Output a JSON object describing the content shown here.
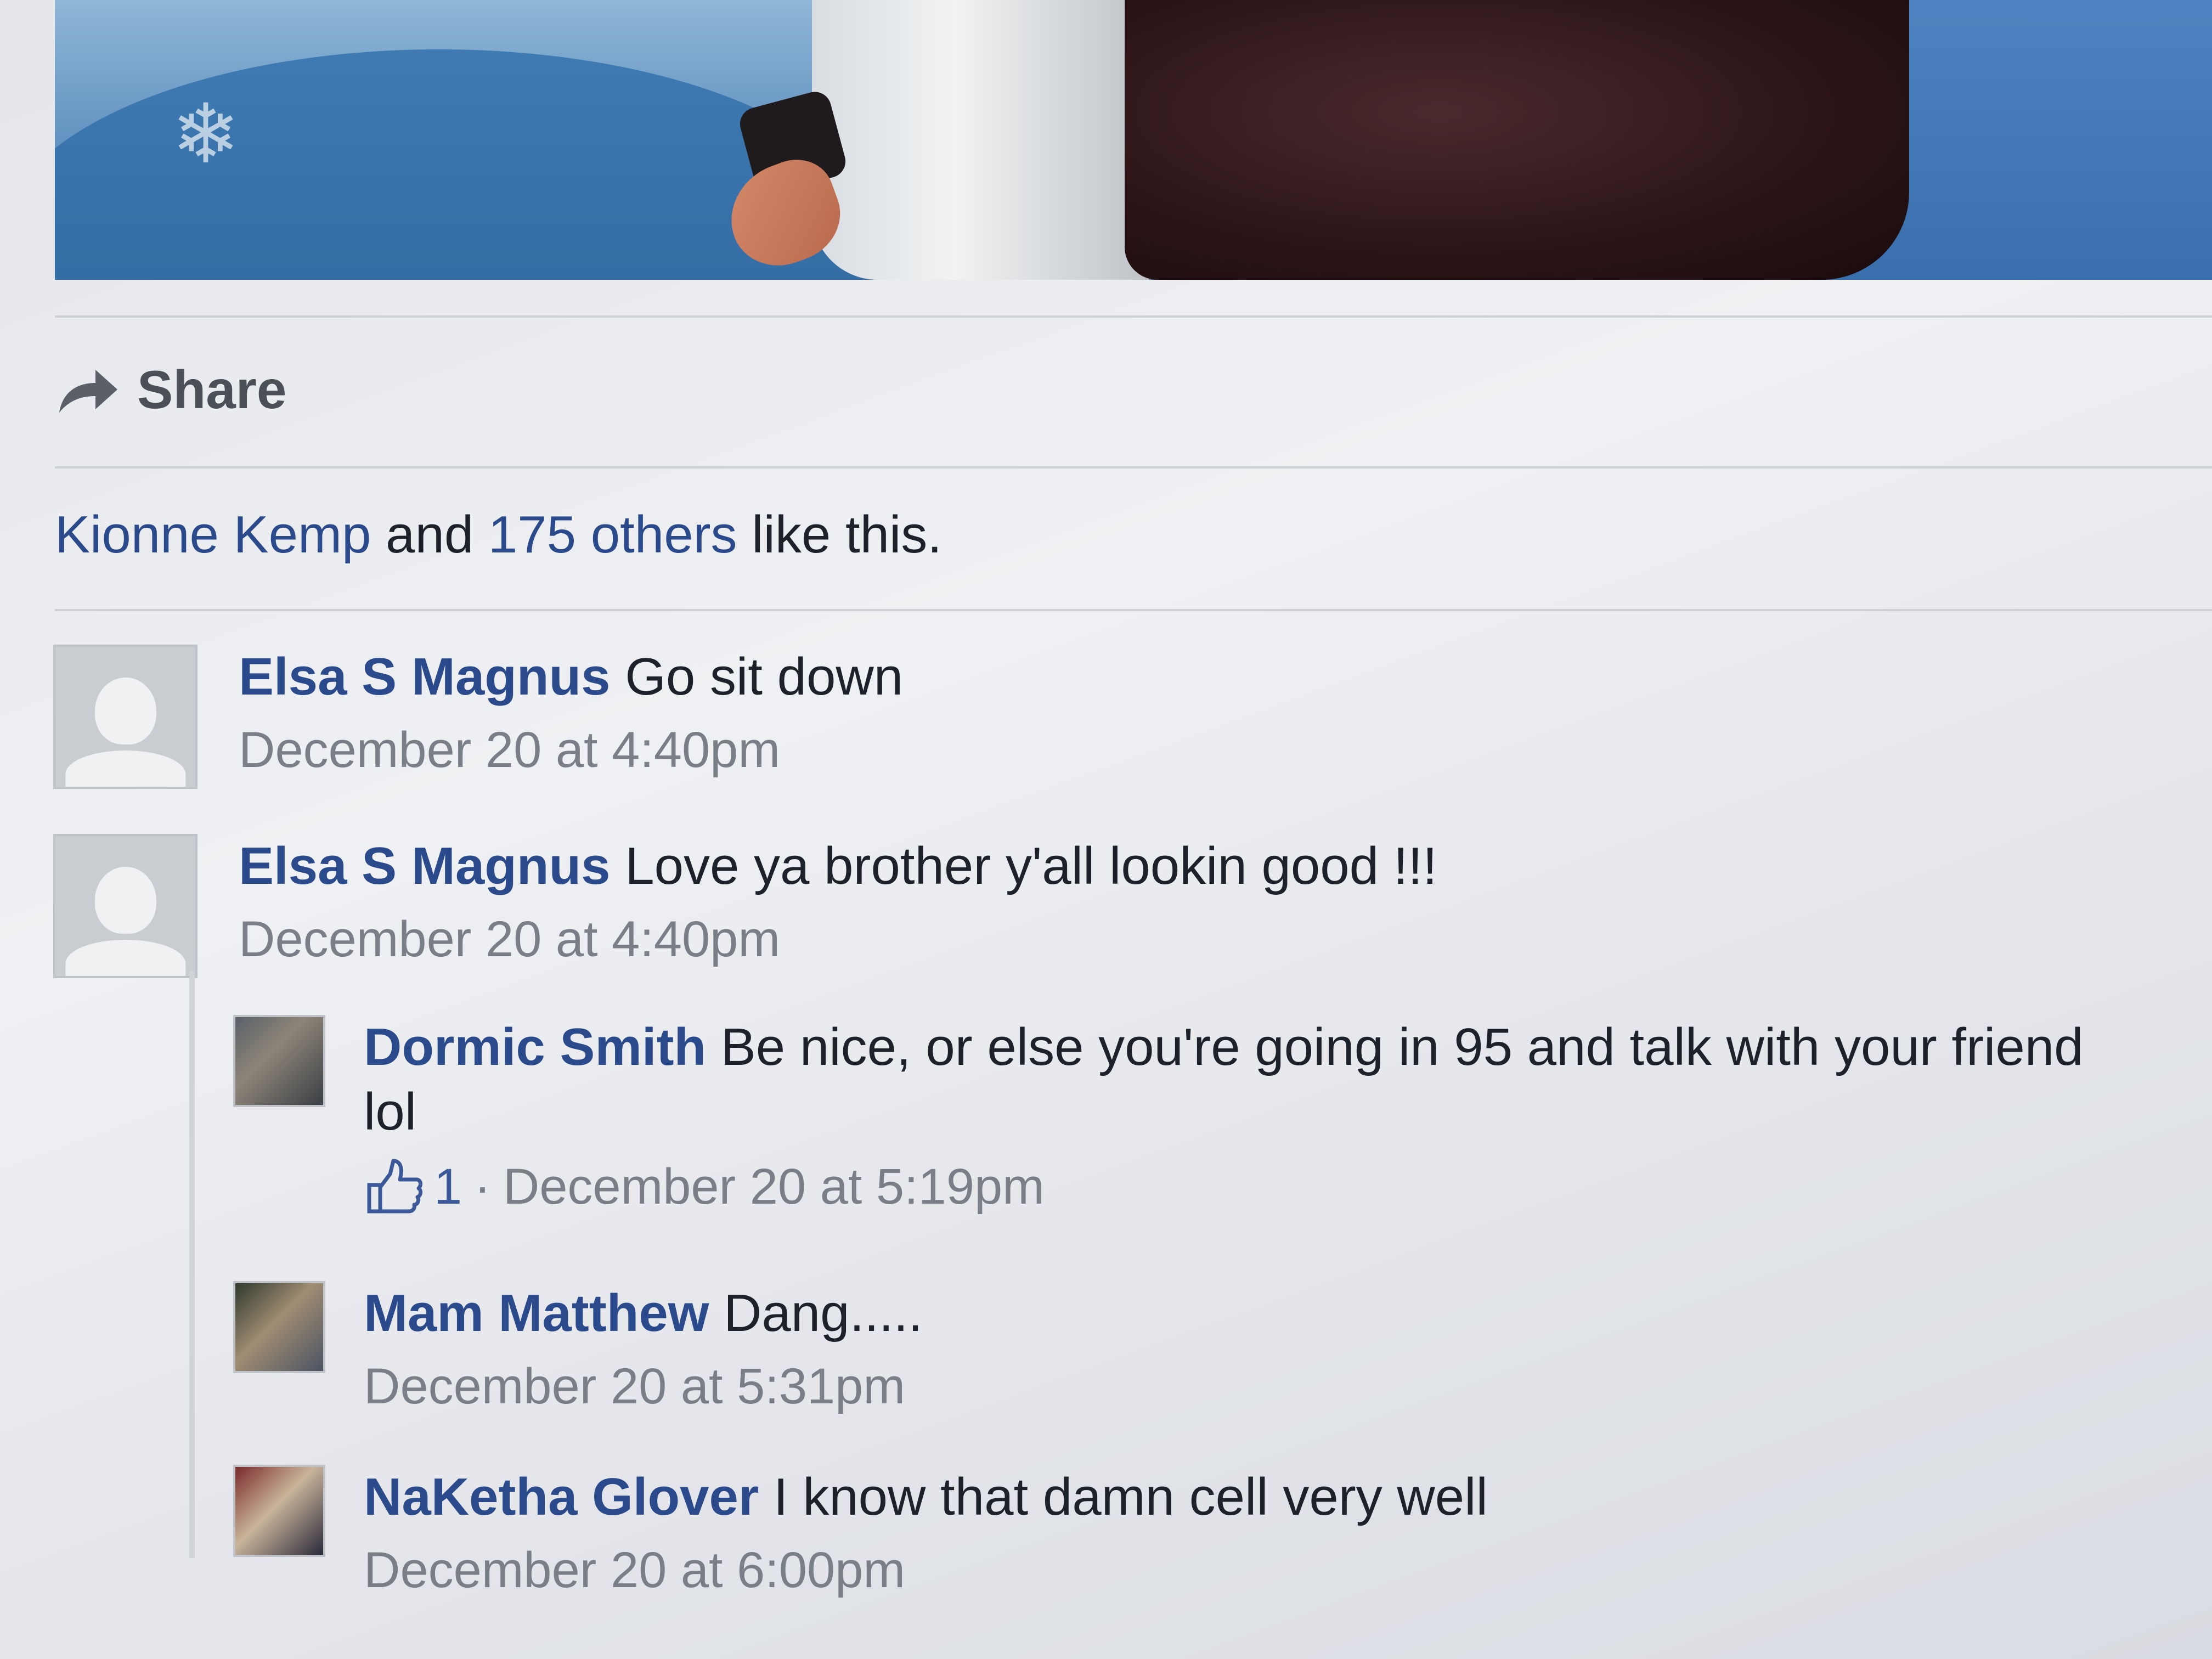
{
  "post": {
    "share_label": "Share",
    "likes": {
      "first_name": "Kionne Kemp",
      "conjunction": " and ",
      "others": "175 others",
      "suffix": " like this."
    }
  },
  "comments": [
    {
      "author": "Elsa S Magnus",
      "text": "Go sit down",
      "time": "December 20 at 4:40pm"
    },
    {
      "author": "Elsa S Magnus",
      "text": "Love ya brother y'all lookin good !!!",
      "time": "December 20 at 4:40pm",
      "replies": [
        {
          "author": "Dormic Smith",
          "text": "Be nice, or else you're going in 95 and talk with your friend lol",
          "likes": "1",
          "separator": "·",
          "time": "December 20 at 5:19pm"
        },
        {
          "author": "Mam Matthew",
          "text": "Dang.....",
          "time": "December 20 at 5:31pm"
        },
        {
          "author": "NaKetha Glover",
          "text": "I know that damn cell very well",
          "time": "December 20 at 6:00pm"
        }
      ]
    }
  ],
  "icons": {
    "share": "share-arrow-icon",
    "like": "thumbs-up-icon",
    "snowflake": "snowflake-icon"
  },
  "colors": {
    "link_blue": "#2a4a8c",
    "text": "#1d2129",
    "meta_gray": "#7a7f87"
  }
}
